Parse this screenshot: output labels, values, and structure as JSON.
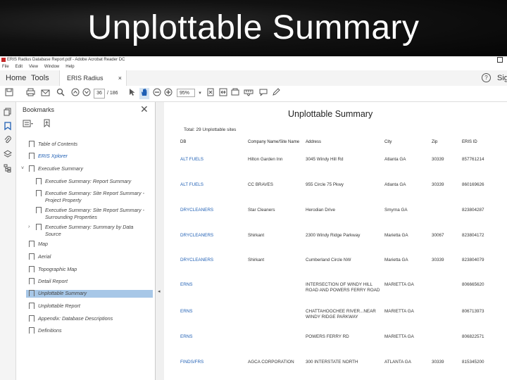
{
  "slide_title": "Unplottable Summary",
  "window": {
    "title": "ERIS Radius Database Report.pdf - Adobe Acrobat Reader DC",
    "menu": [
      "File",
      "Edit",
      "View",
      "Window",
      "Help"
    ]
  },
  "tabs": {
    "home": "Home",
    "tools": "Tools",
    "doc": "ERIS Radius Databa...",
    "doc_close": "×",
    "help": "?",
    "signin": "Sig"
  },
  "toolbar": {
    "page_current": "36",
    "page_total": "/ 186",
    "zoom": "95%",
    "icons": [
      "save-icon",
      "print-icon",
      "email-icon",
      "search-icon",
      "prev-page-icon",
      "next-page-icon",
      "select-cursor-icon",
      "hand-tool-icon",
      "zoom-out-icon",
      "zoom-in-icon",
      "zoom-dropdown-icon",
      "fit-page-icon",
      "fit-width-icon",
      "measure-icon",
      "comment-icon",
      "highlight-pen-icon"
    ]
  },
  "bookmarks": {
    "title": "Bookmarks",
    "close": "✕",
    "items": [
      {
        "label": "Table of Contents",
        "level": 0,
        "blue": false,
        "selected": false,
        "twisty": ""
      },
      {
        "label": "ERIS Xplorer",
        "level": 0,
        "blue": true,
        "selected": false,
        "twisty": ""
      },
      {
        "label": "Executive Summary",
        "level": 0,
        "blue": false,
        "selected": false,
        "twisty": "v"
      },
      {
        "label": "Executive Summary: Report Summary",
        "level": 1,
        "blue": false,
        "selected": false,
        "twisty": ""
      },
      {
        "label": "Executive Summary: Site Report Summary -",
        "label2": "Project Property",
        "level": 1,
        "blue": false,
        "selected": false,
        "twisty": ""
      },
      {
        "label": "Executive Summary: Site Report Summary -",
        "label2": "Surrounding Properties",
        "level": 1,
        "blue": false,
        "selected": false,
        "twisty": ""
      },
      {
        "label": "Executive Summary: Summary by Data",
        "label2": "Source",
        "level": 1,
        "blue": false,
        "selected": false,
        "twisty": ">"
      },
      {
        "label": "Map",
        "level": 0,
        "blue": false,
        "selected": false,
        "twisty": ""
      },
      {
        "label": "Aerial",
        "level": 0,
        "blue": false,
        "selected": false,
        "twisty": ""
      },
      {
        "label": "Topographic Map",
        "level": 0,
        "blue": false,
        "selected": false,
        "twisty": ""
      },
      {
        "label": "Detail Report",
        "level": 0,
        "blue": false,
        "selected": false,
        "twisty": ""
      },
      {
        "label": "Unplottable Summary",
        "level": 0,
        "blue": false,
        "selected": true,
        "twisty": ""
      },
      {
        "label": "Unplottable Report",
        "level": 0,
        "blue": false,
        "selected": false,
        "twisty": ""
      },
      {
        "label": "Appendix: Database Descriptions",
        "level": 0,
        "blue": false,
        "selected": false,
        "twisty": ""
      },
      {
        "label": "Definitions",
        "level": 0,
        "blue": false,
        "selected": false,
        "twisty": ""
      }
    ]
  },
  "document": {
    "title": "Unplottable Summary",
    "total": "Total:  29  Unplottable sites",
    "headers": [
      "DB",
      "Company Name/Site Name",
      "Address",
      "City",
      "Zip",
      "ERIS ID"
    ],
    "rows": [
      {
        "db": "ALT FUELS",
        "company": "Hilton Garden Inn",
        "address": "3045 Windy Hill Rd",
        "city": "Atlanta GA",
        "zip": "30339",
        "eris_id": "857761214"
      },
      {
        "db": "ALT FUELS",
        "company": "CC BRAVES",
        "address": "955 Circle 75 Pkwy",
        "city": "Atlanta GA",
        "zip": "30339",
        "eris_id": "860169626"
      },
      {
        "db": "DRYCLEANERS",
        "company": "Star Cleaners",
        "address": "Herodian Drive",
        "city": "Smyrna GA",
        "zip": "",
        "eris_id": "823804287"
      },
      {
        "db": "DRYCLEANERS",
        "company": "Shirkant",
        "address": "2300 Windy Ridge Parkway",
        "city": "Marietta GA",
        "zip": "30067",
        "eris_id": "823804172"
      },
      {
        "db": "DRYCLEANERS",
        "company": "Shirkant",
        "address": "Cumberland Circle NW",
        "city": "Marietta GA",
        "zip": "30339",
        "eris_id": "823804079"
      },
      {
        "db": "ERNS",
        "company": "",
        "address": "INTERSECTION OF WINDY HILL ROAD AND POWERS FERRY ROAD",
        "city": "MARIETTA GA",
        "zip": "",
        "eris_id": "806665620"
      },
      {
        "db": "ERNS",
        "company": "",
        "address": "CHATTAHOOCHEE RIVER...NEAR WINDY RIDGE PARKWAY",
        "city": "MARIETTA GA",
        "zip": "",
        "eris_id": "806713973"
      },
      {
        "db": "ERNS",
        "company": "",
        "address": "POWERS FERRY RD",
        "city": "MARIETTA GA",
        "zip": "",
        "eris_id": "806822571"
      },
      {
        "db": "FINDS/FRS",
        "company": "AGCA CORPORATION",
        "address": "300 INTERSTATE NORTH",
        "city": "ATLANTA GA",
        "zip": "30339",
        "eris_id": "815345200"
      }
    ]
  }
}
